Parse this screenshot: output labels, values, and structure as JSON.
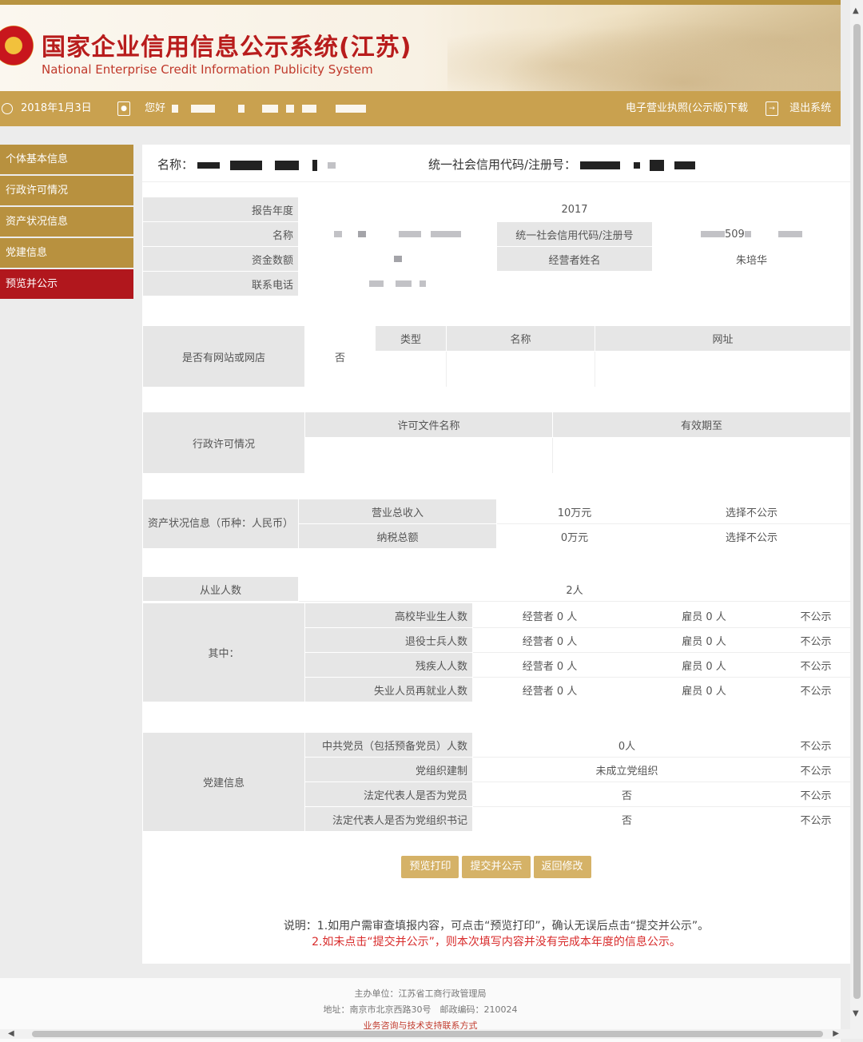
{
  "header": {
    "title": "国家企业信用信息公示系统(江苏)",
    "subtitle_en": "National Enterprise Credit Information Publicity System"
  },
  "toolbar": {
    "date": "2018年1月3日",
    "greeting": "您好",
    "license_download": "电子营业执照(公示版)下载",
    "logout": "退出系统"
  },
  "sidebar": {
    "items": [
      {
        "label": "个体基本信息"
      },
      {
        "label": "行政许可情况"
      },
      {
        "label": "资产状况信息"
      },
      {
        "label": "党建信息"
      },
      {
        "label": "预览并公示"
      }
    ]
  },
  "namebar": {
    "name_label": "名称：",
    "code_label": "统一社会信用代码/注册号："
  },
  "basic": {
    "year_label": "报告年度",
    "year_value": "2017",
    "name_label": "名称",
    "code_label": "统一社会信用代码/注册号",
    "code_partial": "509",
    "capital_label": "资金数额",
    "operator_label": "经营者姓名",
    "operator_value": "朱培华",
    "phone_label": "联系电话"
  },
  "website": {
    "question": "是否有网站或网店",
    "answer": "否",
    "col_type": "类型",
    "col_name": "名称",
    "col_url": "网址"
  },
  "permit": {
    "label": "行政许可情况",
    "col_doc": "许可文件名称",
    "col_valid": "有效期至"
  },
  "assets": {
    "label": "资产状况信息（币种：人民币）",
    "rows": [
      {
        "item": "营业总收入",
        "value": "10万元",
        "public": "选择不公示"
      },
      {
        "item": "纳税总额",
        "value": "0万元",
        "public": "选择不公示"
      }
    ]
  },
  "employees": {
    "label": "从业人数",
    "value": "2人",
    "sub_label": "其中：",
    "rows": [
      {
        "item": "高校毕业生人数",
        "operator": "经营者 0 人",
        "employee": "雇员 0 人",
        "public": "不公示"
      },
      {
        "item": "退役士兵人数",
        "operator": "经营者 0 人",
        "employee": "雇员 0 人",
        "public": "不公示"
      },
      {
        "item": "残疾人人数",
        "operator": "经营者 0 人",
        "employee": "雇员 0 人",
        "public": "不公示"
      },
      {
        "item": "失业人员再就业人数",
        "operator": "经营者 0 人",
        "employee": "雇员 0 人",
        "public": "不公示"
      }
    ]
  },
  "party": {
    "label": "党建信息",
    "rows": [
      {
        "item": "中共党员（包括预备党员）人数",
        "value": "0人",
        "public": "不公示"
      },
      {
        "item": "党组织建制",
        "value": "未成立党组织",
        "public": "不公示"
      },
      {
        "item": "法定代表人是否为党员",
        "value": "否",
        "public": "不公示"
      },
      {
        "item": "法定代表人是否为党组织书记",
        "value": "否",
        "public": "不公示"
      }
    ]
  },
  "buttons": {
    "print": "预览打印",
    "submit": "提交并公示",
    "back": "返回修改"
  },
  "note": {
    "line1": "说明：1.如用户需审查填报内容，可点击“预览打印”，确认无误后点击“提交并公示”。",
    "line2": "2.如未点击“提交并公示”，则本次填写内容并没有完成本年度的信息公示。"
  },
  "footer": {
    "host": "主办单位：江苏省工商行政管理局",
    "address": "地址：南京市北京西路30号　邮政编码：210024",
    "support": "业务咨询与技术支持联系方式"
  }
}
